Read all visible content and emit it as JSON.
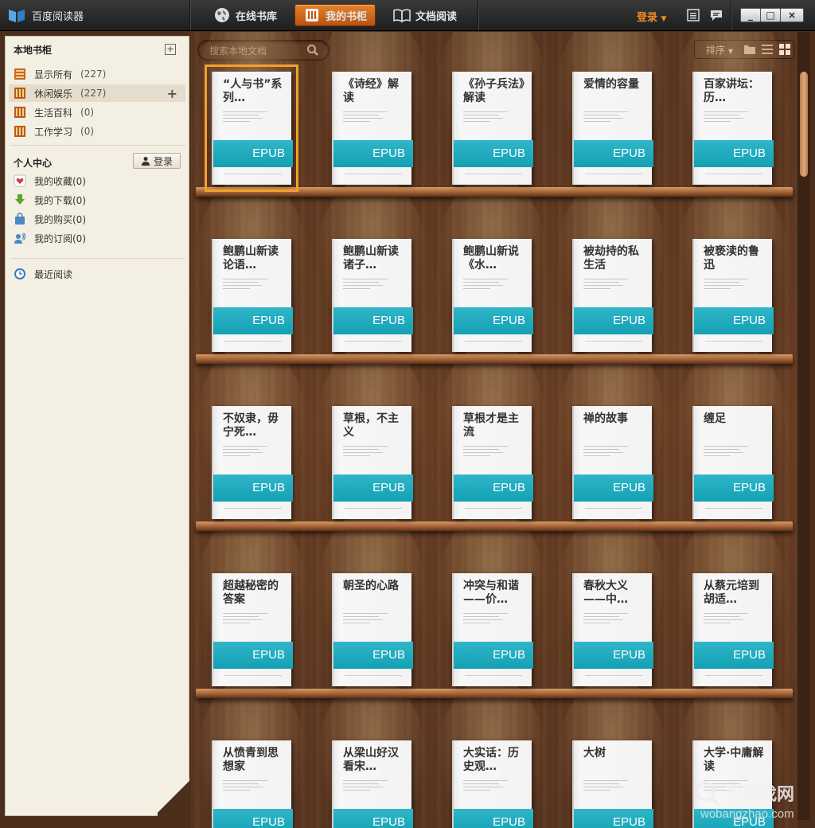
{
  "app": {
    "title": "百度阅读器",
    "login": "登录"
  },
  "nav": {
    "tabs": [
      {
        "label": "在线书库",
        "active": false
      },
      {
        "label": "我的书柜",
        "active": true
      },
      {
        "label": "文档阅读",
        "active": false
      }
    ]
  },
  "window_controls": [
    "_",
    "□",
    "×"
  ],
  "sidebar": {
    "local_header": "本地书柜",
    "add_icon": "+",
    "shelves": [
      {
        "label": "显示所有",
        "count": "(227)",
        "icon": "shelf-all-icon"
      },
      {
        "label": "休闲娱乐",
        "count": "(227)",
        "icon": "shelf-icon",
        "active": true,
        "add": "+"
      },
      {
        "label": "生活百科",
        "count": "(0)",
        "icon": "shelf-icon"
      },
      {
        "label": "工作学习",
        "count": "(0)",
        "icon": "shelf-icon"
      }
    ],
    "personal_header": "个人中心",
    "login_button": "登录",
    "personal": [
      {
        "label": "我的收藏(0)",
        "icon": "heart-icon"
      },
      {
        "label": "我的下载(0)",
        "icon": "download-arrow-icon"
      },
      {
        "label": "我的购买(0)",
        "icon": "shopping-bag-icon"
      },
      {
        "label": "我的订阅(0)",
        "icon": "subscribe-icon"
      }
    ],
    "recent": {
      "label": "最近阅读",
      "icon": "clock-icon"
    }
  },
  "toolbar": {
    "search_placeholder": "搜索本地文档",
    "sort_label": "排序",
    "views": [
      "folder-icon",
      "list-view-icon",
      "grid-view-icon"
    ]
  },
  "books": [
    {
      "title": "“人与书”系列…",
      "format": "EPUB",
      "selected": true
    },
    {
      "title": "《诗经》解读",
      "format": "EPUB"
    },
    {
      "title": "《孙子兵法》解读",
      "format": "EPUB"
    },
    {
      "title": "爱情的容量",
      "format": "EPUB"
    },
    {
      "title": "百家讲坛：历…",
      "format": "EPUB"
    },
    {
      "title": "鲍鹏山新读论语…",
      "format": "EPUB"
    },
    {
      "title": "鲍鹏山新读诸子…",
      "format": "EPUB"
    },
    {
      "title": "鲍鹏山新说《水…",
      "format": "EPUB"
    },
    {
      "title": "被劫持的私生活",
      "format": "EPUB"
    },
    {
      "title": "被亵渎的鲁迅",
      "format": "EPUB"
    },
    {
      "title": "不奴隶，毋宁死…",
      "format": "EPUB"
    },
    {
      "title": "草根，不主义",
      "format": "EPUB"
    },
    {
      "title": "草根才是主流",
      "format": "EPUB"
    },
    {
      "title": "禅的故事",
      "format": "EPUB"
    },
    {
      "title": "缠足",
      "format": "EPUB"
    },
    {
      "title": "超越秘密的答案",
      "format": "EPUB"
    },
    {
      "title": "朝圣的心路",
      "format": "EPUB"
    },
    {
      "title": "冲突与和谐——价…",
      "format": "EPUB"
    },
    {
      "title": "春秋大义——中…",
      "format": "EPUB"
    },
    {
      "title": "从蔡元培到胡适…",
      "format": "EPUB"
    },
    {
      "title": "从愤青到思想家",
      "format": "EPUB"
    },
    {
      "title": "从梁山好汉看宋…",
      "format": "EPUB"
    },
    {
      "title": "大实话：历史观…",
      "format": "EPUB"
    },
    {
      "title": "大树",
      "format": "EPUB"
    },
    {
      "title": "大学·中庸解读",
      "format": "EPUB"
    }
  ],
  "watermark": {
    "text": "我帮找网",
    "url": "wobangzhao.com"
  }
}
